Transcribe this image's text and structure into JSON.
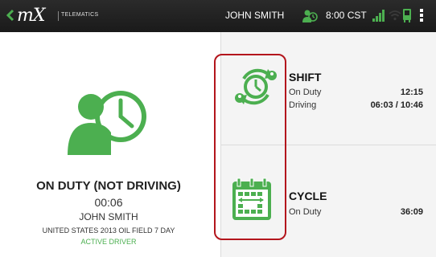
{
  "topbar": {
    "logo_text": "mX",
    "logo_sub": "TELEMATICS",
    "user_name": "JOHN SMITH",
    "time": "8:00 CST",
    "accent": "#4caf50"
  },
  "status": {
    "title": "ON DUTY (NOT DRIVING)",
    "elapsed": "00:06",
    "driver": "JOHN SMITH",
    "ruleset": "UNITED STATES 2013 OIL FIELD 7 DAY",
    "role": "ACTIVE DRIVER"
  },
  "shift": {
    "title": "SHIFT",
    "rows": [
      {
        "label": "On Duty",
        "value": "12:15"
      },
      {
        "label": "Driving",
        "value": "06:03 / 10:46"
      }
    ]
  },
  "cycle": {
    "title": "CYCLE",
    "rows": [
      {
        "label": "On Duty",
        "value": "36:09"
      }
    ]
  },
  "colors": {
    "green": "#4caf50",
    "highlight": "#b3151c"
  }
}
